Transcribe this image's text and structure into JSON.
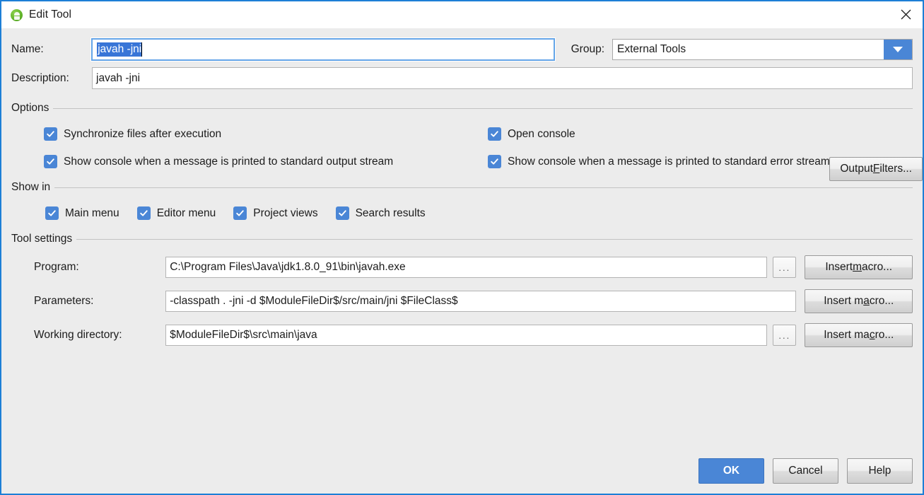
{
  "window": {
    "title": "Edit Tool",
    "icon": "android-studio-icon",
    "close_icon": "close-icon",
    "accent_color": "#4a86d6",
    "border_color": "#1d7fd6",
    "selection_color": "#3875d7",
    "background_color": "#ececec"
  },
  "form": {
    "name_label": "Name:",
    "name_value": "javah -jni",
    "name_selected": true,
    "group_label": "Group:",
    "group_value": "External Tools",
    "group_options": [
      "External Tools"
    ],
    "description_label": "Description:",
    "description_value": "javah -jni"
  },
  "options": {
    "section_label": "Options",
    "items": [
      {
        "label": "Synchronize files after execution",
        "checked": true
      },
      {
        "label": "Open console",
        "checked": true
      },
      {
        "label": "Show console when a message is printed to standard output stream",
        "checked": true
      },
      {
        "label": "Show console when a message is printed to standard error stream",
        "checked": true
      }
    ],
    "output_filters_button": {
      "prefix": "Output ",
      "mnemonic": "F",
      "suffix": "ilters..."
    }
  },
  "show_in": {
    "section_label": "Show in",
    "items": [
      {
        "label": "Main menu",
        "checked": true
      },
      {
        "label": "Editor menu",
        "checked": true
      },
      {
        "label": "Project views",
        "checked": true
      },
      {
        "label": "Search results",
        "checked": true
      }
    ]
  },
  "tool_settings": {
    "section_label": "Tool settings",
    "program": {
      "label": "Program:",
      "value": "C:\\Program Files\\Java\\jdk1.8.0_91\\bin\\javah.exe",
      "browse_label": "...",
      "macro_prefix": "Insert ",
      "macro_mnemonic": "m",
      "macro_suffix": "acro..."
    },
    "parameters": {
      "label": "Parameters:",
      "value": "-classpath . -jni -d $ModuleFileDir$/src/main/jni $FileClass$",
      "macro_prefix": "Insert ma",
      "macro_mnemonic": "c",
      "macro_suffix": "ro..."
    },
    "working_directory": {
      "label": "Working directory:",
      "value": "$ModuleFileDir$\\src\\main\\java",
      "browse_label": "...",
      "macro_prefix": "Insert ma",
      "macro_mnemonic": "c",
      "macro_suffix": "ro..."
    },
    "parameters_macro": {
      "prefix": "Insert m",
      "mnemonic": "a",
      "suffix": "cro..."
    }
  },
  "footer": {
    "ok_label": "OK",
    "cancel_label": "Cancel",
    "help_label": "Help"
  }
}
